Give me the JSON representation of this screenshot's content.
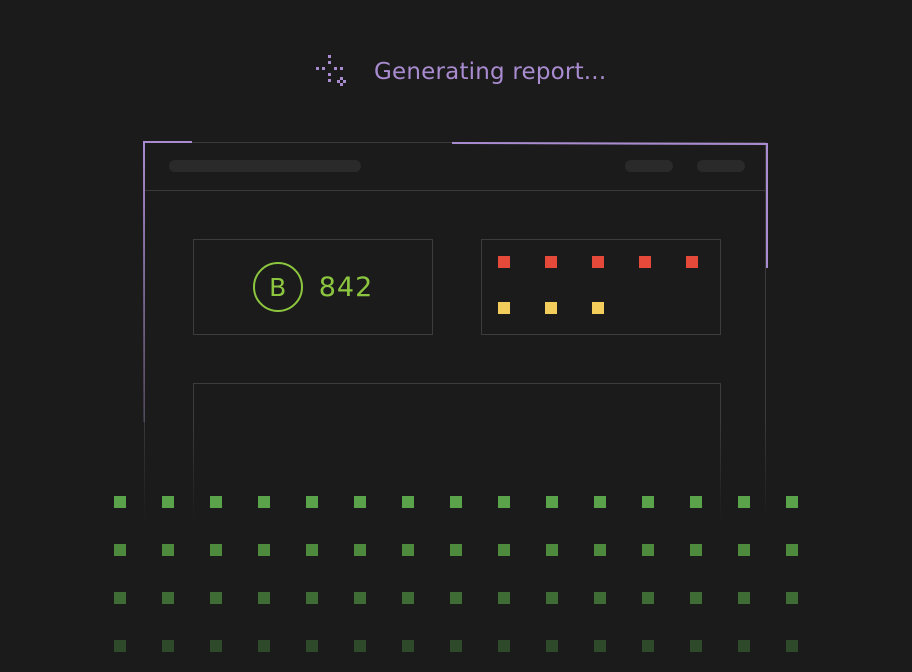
{
  "status": {
    "label": "Generating report...",
    "icon": "sparkle-icon",
    "color": "#a98bd0"
  },
  "report_preview": {
    "grade": "B",
    "score": "842",
    "grade_color": "#8cc63f",
    "issue_markers": {
      "rows": [
        {
          "color": "#e4493a",
          "count": 5
        },
        {
          "color": "#f2cd5c",
          "count": 3
        }
      ]
    }
  },
  "loading_grid": {
    "columns": 15,
    "row_colors": [
      "#5aa34a",
      "#4d8a3e",
      "#3f6b35",
      "#2f4a2b"
    ]
  },
  "colors": {
    "background": "#1b1b1b",
    "border": "#3a3a3a",
    "progress": "#a98bd0"
  }
}
